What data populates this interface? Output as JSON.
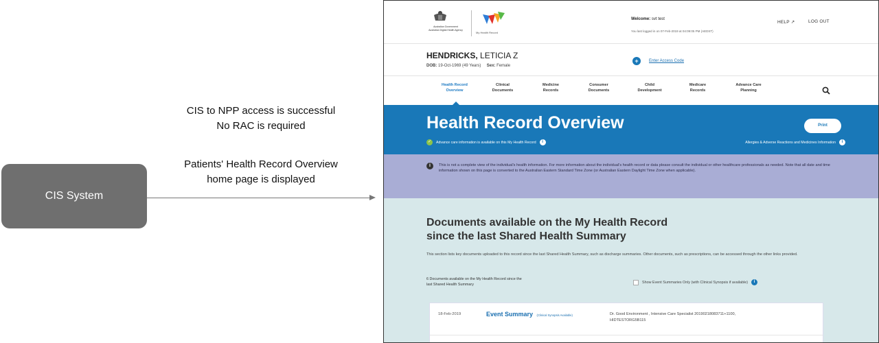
{
  "diagram": {
    "source_box": "CIS System",
    "note1_line1": "CIS to NPP access is successful",
    "note1_line2": "No RAC is required",
    "note2_line1": "Patients' Health Record Overview",
    "note2_line2": "home page is displayed"
  },
  "screen": {
    "header": {
      "gov_line1": "Australian Government",
      "gov_line2": "Australian Digital Health Agency",
      "mhr_label": "My Health Record",
      "welcome_label": "Welcome:",
      "welcome_user": "svt test",
      "last_logged": "You last logged in on 07-Feb-2019 at 04:09:05 PM (AEDST)",
      "help": "HELP",
      "logout": "LOG OUT"
    },
    "patient": {
      "surname": "HENDRICKS,",
      "given": "LETICIA Z",
      "dob_label": "DOB:",
      "dob_value": "19-Oct-1969 (49 Years)",
      "sex_label": "Sex:",
      "sex_value": "Female",
      "access_link": "Enter Access Code"
    },
    "nav": [
      {
        "l1": "Health Record",
        "l2": "Overview"
      },
      {
        "l1": "Clinical",
        "l2": "Documents"
      },
      {
        "l1": "Medicine",
        "l2": "Records"
      },
      {
        "l1": "Consumer",
        "l2": "Documents"
      },
      {
        "l1": "Child",
        "l2": "Development"
      },
      {
        "l1": "Medicare",
        "l2": "Records"
      },
      {
        "l1": "Advance Care",
        "l2": "Planning"
      }
    ],
    "banner": {
      "title": "Health Record Overview",
      "print": "Print",
      "advance_info": "Advance care information is available on this My Health Record",
      "allergies": "Allergies & Adverse Reactions and Medicines Information"
    },
    "notice": "This is not a complete view of the individual's health information. For more information about the individual's health record or data please consult the individual or other healthcare professionals as needed. Note that all date and time information shown on this page is converted to the Australian Eastern Standard Time Zone (or Australian Eastern Daylight Time Zone when applicable).",
    "docs": {
      "heading_l1": "Documents available on the My Health Record",
      "heading_l2": "since the last Shared Health Summary",
      "description": "This section lists key documents uploaded to this record since the last Shared Health Summary, such as discharge summaries. Other documents, such as prescriptions, can be accessed through the other links provided.",
      "count_l1": "6 Documents available on the My Health Record since the",
      "count_l2": "last Shared Health Summary",
      "filter_label": "Show Event Summaries Only (with Clinical Synopsis if available)",
      "row": {
        "date": "18-Feb-2019",
        "title": "Event Summary",
        "title_sub": "(Clinical Synopsis Available)",
        "author_l1": "Dr. Good Environment , Intensive Care Specialist 20190218083711+1100,",
        "author_l2": "HIDTESTORG5B115"
      }
    }
  },
  "colors": {
    "box_gray": "#6f6f6f",
    "banner_blue": "#1978b8",
    "notice_purple": "#a9add5",
    "docs_bg": "#d7e8ea"
  }
}
